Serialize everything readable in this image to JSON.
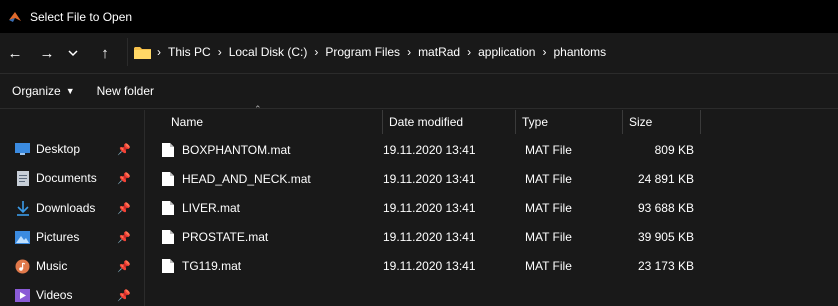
{
  "window": {
    "title": "Select File to Open"
  },
  "address_bar": {
    "crumbs": [
      "This PC",
      "Local Disk (C:)",
      "Program Files",
      "matRad",
      "application",
      "phantoms"
    ]
  },
  "toolbar": {
    "organize_label": "Organize",
    "new_folder_label": "New folder"
  },
  "sidebar": {
    "items": [
      {
        "label": "Desktop",
        "icon": "desktop-icon"
      },
      {
        "label": "Documents",
        "icon": "documents-icon"
      },
      {
        "label": "Downloads",
        "icon": "downloads-icon"
      },
      {
        "label": "Pictures",
        "icon": "pictures-icon"
      },
      {
        "label": "Music",
        "icon": "music-icon"
      },
      {
        "label": "Videos",
        "icon": "videos-icon"
      }
    ]
  },
  "file_list": {
    "columns": {
      "name": "Name",
      "date": "Date modified",
      "type": "Type",
      "size": "Size"
    },
    "rows": [
      {
        "name": "BOXPHANTOM.mat",
        "date": "19.11.2020 13:41",
        "type": "MAT File",
        "size": "809 KB"
      },
      {
        "name": "HEAD_AND_NECK.mat",
        "date": "19.11.2020 13:41",
        "type": "MAT File",
        "size": "24 891 KB"
      },
      {
        "name": "LIVER.mat",
        "date": "19.11.2020 13:41",
        "type": "MAT File",
        "size": "93 688 KB"
      },
      {
        "name": "PROSTATE.mat",
        "date": "19.11.2020 13:41",
        "type": "MAT File",
        "size": "39 905 KB"
      },
      {
        "name": "TG119.mat",
        "date": "19.11.2020 13:41",
        "type": "MAT File",
        "size": "23 173 KB"
      }
    ]
  },
  "colors": {
    "background": "#191919",
    "titlebar": "#000000",
    "text": "#ffffff",
    "folder": "#f5c04a",
    "accent": "#3b8be0"
  }
}
